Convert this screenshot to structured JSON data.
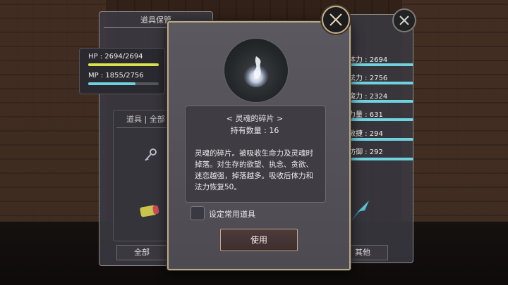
{
  "rear_left": {
    "title": "道具保管",
    "hp_label": "HP : 2694/2694",
    "mp_label": "MP : 1855/2756",
    "hp_fraction": 1.0,
    "mp_fraction": 0.673,
    "inventory_tabs": "道具 | 全部",
    "all_button": "全部"
  },
  "rear_right": {
    "stats": [
      {
        "label": "体力 : 2694"
      },
      {
        "label": "法力 : 2756"
      },
      {
        "label": "魔力 : 2324"
      },
      {
        "label": "力量 : 631"
      },
      {
        "label": "敏捷 : 294"
      },
      {
        "label": "防御 : 292"
      }
    ],
    "other_button": "其他"
  },
  "dialog": {
    "item_name": "< 灵魂的碎片 >",
    "quantity": "持有数量 :  16",
    "description": "灵魂的碎片。被吸收生命力及灵魂时掉落。对生存的欲望、执念、贪欲、迷恋越强，掉落越多。吸收后体力和法力恢复50。",
    "checkbox_label": "设定常用道具",
    "use_button": "使用"
  },
  "colors": {
    "hp_bar": "#d8e34d",
    "mp_bar": "#6fd3df",
    "frame_gold": "#b9aa88"
  },
  "icons": [
    "close-icon",
    "soul-flame-icon",
    "key-icon",
    "scroll-icon",
    "crystal-icon"
  ]
}
